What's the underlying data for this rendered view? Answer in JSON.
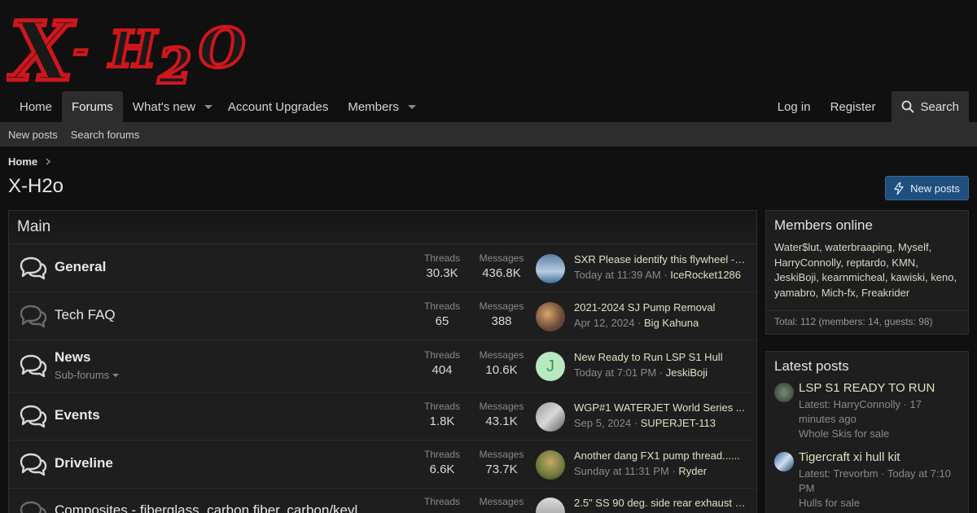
{
  "logo": {
    "text": "X-H2O"
  },
  "nav": {
    "home": "Home",
    "forums": "Forums",
    "whats_new": "What's new",
    "account_upgrades": "Account Upgrades",
    "members": "Members",
    "login": "Log in",
    "register": "Register",
    "search": "Search"
  },
  "subnav": {
    "new_posts": "New posts",
    "search_forums": "Search forums"
  },
  "breadcrumb": {
    "home": "Home"
  },
  "page": {
    "title": "X-H2o",
    "new_posts_button": "New posts"
  },
  "main": {
    "heading": "Main",
    "threads_label": "Threads",
    "messages_label": "Messages",
    "nodes": [
      {
        "title": "General",
        "threads": "30.3K",
        "messages": "436.8K",
        "last_title": "SXR Please identify this flywheel -S...",
        "last_date": "Today at 11:39 AM",
        "last_user": "IceRocket1286"
      },
      {
        "title": "Tech FAQ",
        "threads": "65",
        "messages": "388",
        "last_title": "2021-2024 SJ Pump Removal",
        "last_date": "Apr 12, 2024",
        "last_user": "Big Kahuna"
      },
      {
        "title": "News",
        "subforums": "Sub-forums",
        "threads": "404",
        "messages": "10.6K",
        "last_title": "New Ready to Run LSP S1 Hull",
        "last_date": "Today at 7:01 PM",
        "last_user": "JeskiBoji",
        "avatar_letter": "J"
      },
      {
        "title": "Events",
        "threads": "1.8K",
        "messages": "43.1K",
        "last_title": "WGP#1 WATERJET World Series ...",
        "last_date": "Sep 5, 2024",
        "last_user": "SUPERJET-113"
      },
      {
        "title": "Driveline",
        "threads": "6.6K",
        "messages": "73.7K",
        "last_title": "Another dang FX1 pump thread......",
        "last_date": "Sunday at 11:31 PM",
        "last_user": "Ryder"
      },
      {
        "title": "Composites - fiberglass, carbon fiber, carbon/kevl",
        "threads": "",
        "messages": "",
        "last_title": "2.5\" SS 90 deg. side rear exhaust o...",
        "last_date": "",
        "last_user": ""
      }
    ]
  },
  "members_online": {
    "heading": "Members online",
    "names": [
      "Water$lut",
      "waterbraaping",
      "Myself",
      "HarryConnolly",
      "reptardo",
      "KMN",
      "JeskiBoji",
      "kearnmicheal",
      "kawiski",
      "keno",
      "yamabro",
      "Mich-fx",
      "Freakrider"
    ],
    "total": "Total: 112 (members: 14, guests: 98)"
  },
  "latest_posts": {
    "heading": "Latest posts",
    "items": [
      {
        "title": "LSP S1 READY TO RUN",
        "meta": "Latest: HarryConnolly · 17 minutes ago",
        "forum": "Whole Skis for sale"
      },
      {
        "title": "Tigercraft xi hull kit",
        "meta": "Latest: Trevorbm · Today at 7:10 PM",
        "forum": "Hulls for sale"
      }
    ]
  },
  "colors": {
    "accent_button": "#1f4f7c",
    "link_text": "#e0e0c0",
    "logo_red": "#d0161c"
  }
}
